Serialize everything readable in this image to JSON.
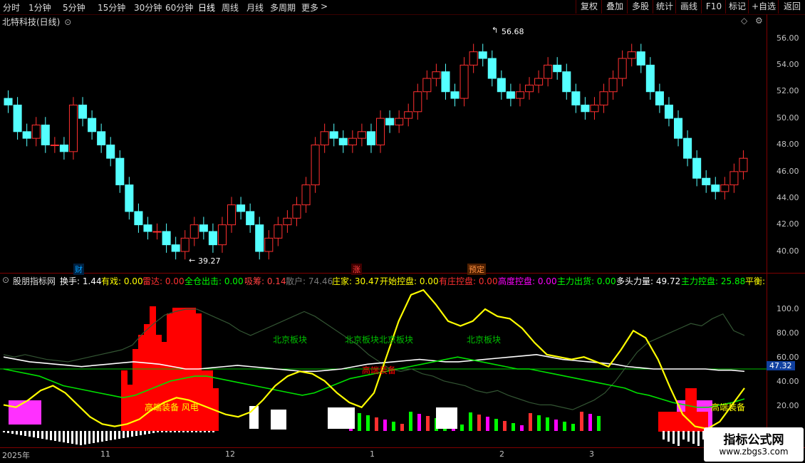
{
  "toolbar": {
    "left": [
      "分时",
      "1分钟",
      "5分钟",
      "15分钟",
      "30分钟",
      "60分钟",
      "日线",
      "周线",
      "月线",
      "多周期",
      "更多"
    ],
    "more_arrow": ">",
    "right": [
      "复权",
      "叠加",
      "多股",
      "统计",
      "画线",
      "F10",
      "标记",
      "+自选",
      "返回"
    ]
  },
  "stock": {
    "title": "北特科技(日线)",
    "badge": "⊙"
  },
  "price_axis": [
    "56.00",
    "54.00",
    "52.00",
    "50.00",
    "48.00",
    "46.00",
    "44.00",
    "42.00",
    "40.00"
  ],
  "annotations": {
    "high": "56.68",
    "low": "39.27"
  },
  "events": [
    {
      "label": "财",
      "color": "#00a0ff"
    },
    {
      "label": "涨",
      "color": "#ff4040"
    },
    {
      "label": "预定",
      "color": "#ff9040"
    }
  ],
  "indicator": {
    "name": "股朋指标网",
    "items": [
      {
        "label": "换手: 1.44",
        "color": "#ffffff"
      },
      {
        "label": "有戏: 0.00",
        "color": "#ffff00"
      },
      {
        "label": "雷达: 0.00",
        "color": "#ff3030"
      },
      {
        "label": "全仓出击: 0.00",
        "color": "#00ff00"
      },
      {
        "label": "吸筹: 0.14",
        "color": "#ff4040"
      },
      {
        "label": "散户: 74.46",
        "color": "#777777"
      },
      {
        "label": "庄家: 30.47",
        "color": "#ffff00"
      },
      {
        "label": "开始控盘: 0.00",
        "color": "#ffff00"
      },
      {
        "label": "有庄控盘: 0.00",
        "color": "#ff3030"
      },
      {
        "label": "高度控盘: 0.00",
        "color": "#ff00ff"
      },
      {
        "label": "主力出货: 0.00",
        "color": "#00ff00"
      },
      {
        "label": "多头力量: 49.72",
        "color": "#ffffff"
      },
      {
        "label": "主力控盘: 25.88",
        "color": "#00ff00"
      },
      {
        "label": "平衡:",
        "color": "#ffff00"
      }
    ]
  },
  "indicator_axis": [
    "100.0",
    "80.00",
    "60.00",
    "40.00",
    "20.00"
  ],
  "current_value": "47.32",
  "overlay_texts": [
    {
      "text": "北京板块",
      "color": "#00c000"
    },
    {
      "text": "北京板块北京板块",
      "color": "#00c000"
    },
    {
      "text": "北京板块",
      "color": "#00c000"
    },
    {
      "text": "高端装备 风电",
      "color": "#ffff00"
    },
    {
      "text": "高端装备",
      "color": "#ffff00"
    },
    {
      "text": "高端装备",
      "color": "#ff0000"
    }
  ],
  "dates": [
    "2025年",
    "11",
    "12",
    "1",
    "2",
    "3"
  ],
  "watermark": {
    "title": "指标公式网",
    "url": "www.zbgs3.com"
  }
}
